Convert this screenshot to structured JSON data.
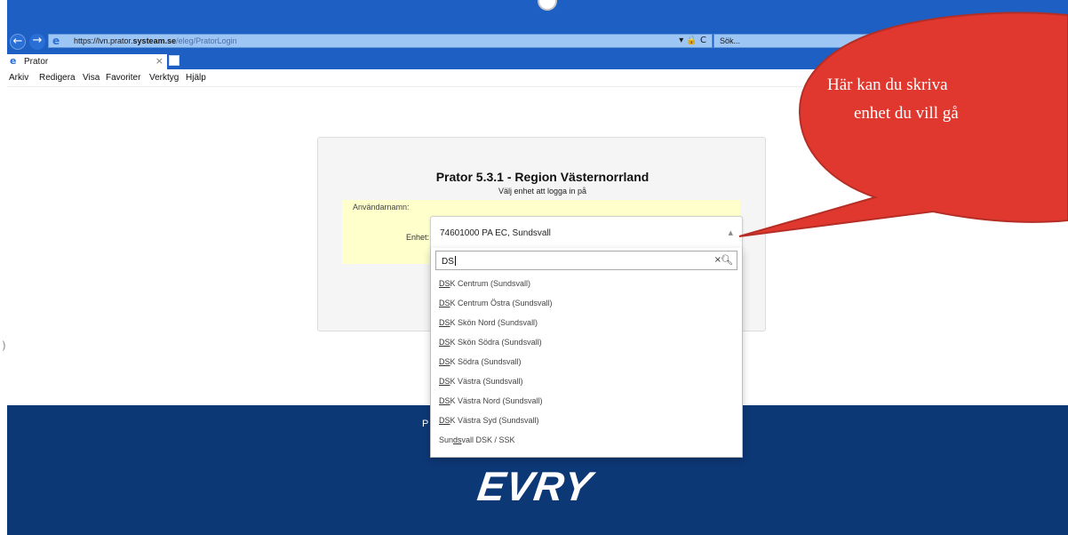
{
  "browser": {
    "url_host": "https://lvn.prator.",
    "url_domain": "systeam.se",
    "url_path": "/eleg/PratorLogin",
    "url_tools": "▾ 🔒 C",
    "search_placeholder": "Sök...",
    "tab_title": "Prator",
    "tab_close": "×",
    "back_icon": "←",
    "forward_icon": "→"
  },
  "menu": {
    "items": [
      "Arkiv",
      "Redigera",
      "Visa",
      "Favoriter",
      "Verktyg",
      "Hjälp"
    ]
  },
  "login": {
    "title": "Prator 5.3.1 - Region Västernorrland",
    "subtitle": "Välj enhet att logga in på",
    "username_label": "Användarnamn:",
    "unit_label": "Enhet:",
    "selected_unit": "74601000 PA EC, Sundsvall",
    "select_arrow": "▲",
    "search_value": "DS",
    "search_clear": "×",
    "search_icon": "⚲",
    "options": [
      {
        "match": "DS",
        "rest": "K Centrum (Sundsvall)"
      },
      {
        "match": "DS",
        "rest": "K Centrum Östra (Sundsvall)"
      },
      {
        "match": "DS",
        "rest": "K Skön Nord (Sundsvall)"
      },
      {
        "match": "DS",
        "rest": "K Skön Södra (Sundsvall)"
      },
      {
        "match": "DS",
        "rest": "K Södra (Sundsvall)"
      },
      {
        "match": "DS",
        "rest": "K Västra (Sundsvall)"
      },
      {
        "match": "DS",
        "rest": "K Västra Nord (Sundsvall)"
      },
      {
        "match": "DS",
        "rest": "K Västra Syd (Sundsvall)"
      }
    ],
    "last_option": {
      "pre": "Sun",
      "match": "ds",
      "rest": "vall DSK / SSK"
    }
  },
  "footer": {
    "text_fragment": "P",
    "logo": "EVRY",
    "color": "#0d3876"
  },
  "callout": {
    "line1": "Här kan du skriva",
    "line2": "enhet du vill gå",
    "color": "#e0382f"
  },
  "side_glyph": ")"
}
